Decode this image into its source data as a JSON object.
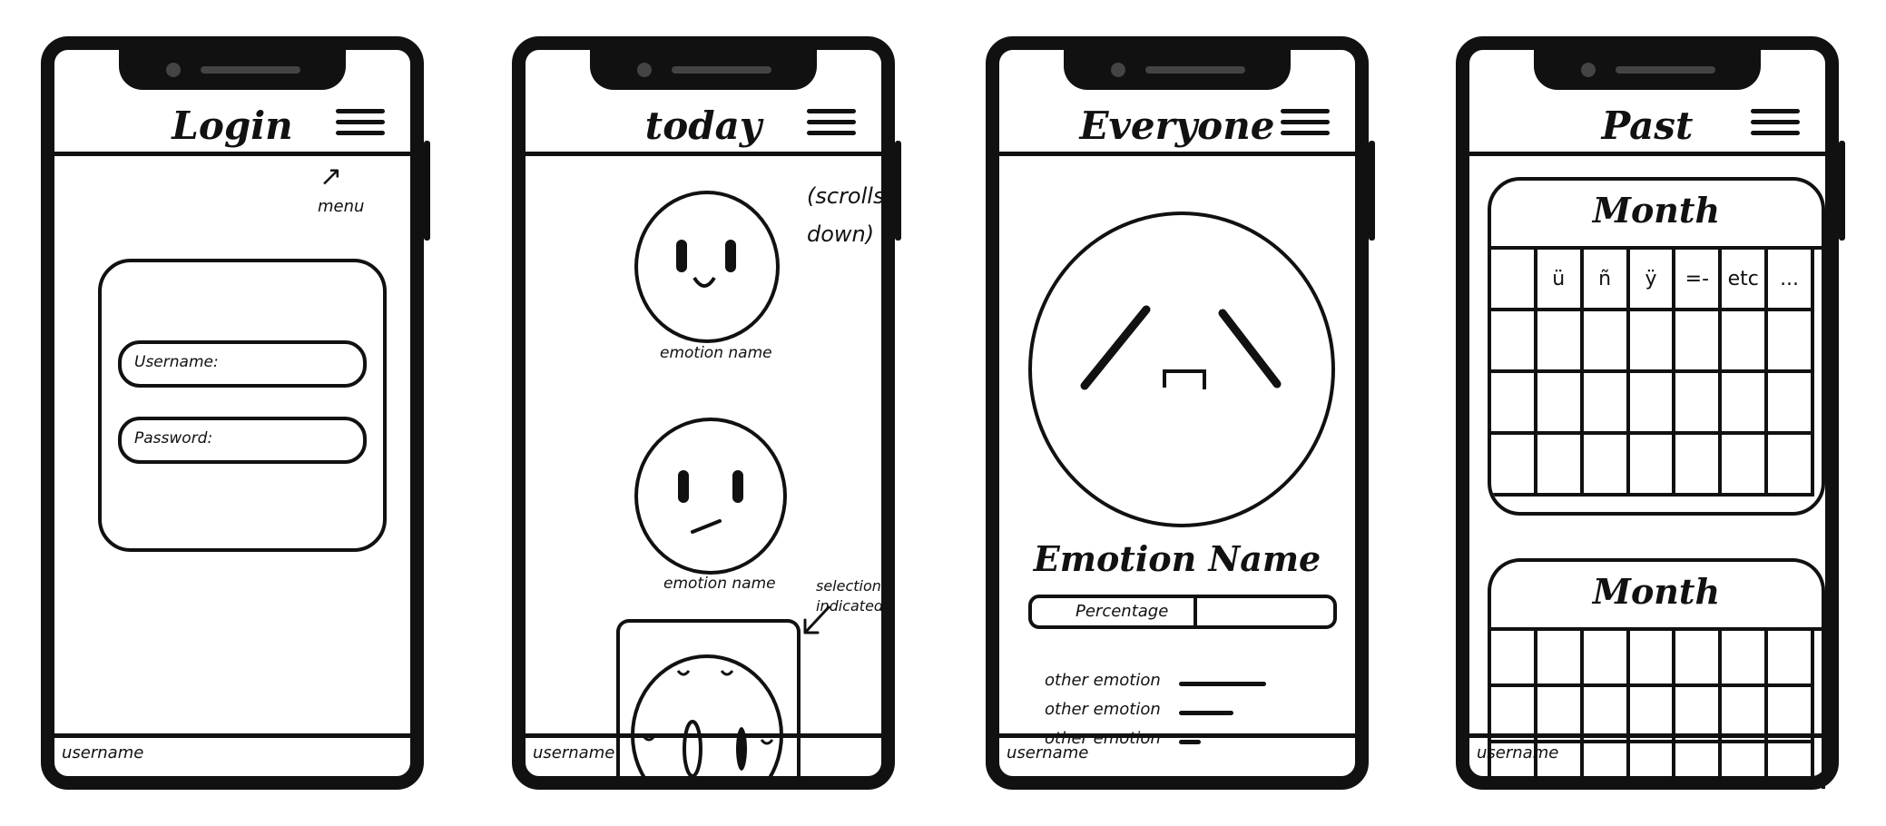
{
  "screens": [
    {
      "title": "Login",
      "menu_annotation": "menu",
      "fields": [
        {
          "label": "Username:"
        },
        {
          "label": "Password:"
        }
      ],
      "footer_username": "username"
    },
    {
      "title": "today",
      "scroll_note": "(scrolls down)",
      "emotions": [
        {
          "label": "emotion name"
        },
        {
          "label": "emotion name"
        }
      ],
      "selection_note": "selection indicated",
      "footer_username": "username"
    },
    {
      "title": "Everyone",
      "emotion_name": "Emotion Name",
      "percentage_label": "Percentage",
      "percentage_fraction": 0.55,
      "other_emotions": [
        {
          "label": "other emotion",
          "fraction": 0.8
        },
        {
          "label": "other emotion",
          "fraction": 0.5
        },
        {
          "label": "other emotion",
          "fraction": 0.2
        }
      ],
      "footer_username": "username"
    },
    {
      "title": "Past",
      "calendars": [
        {
          "month_label": "Month",
          "first_row": [
            "",
            "ü",
            "ñ",
            "ÿ",
            "=-",
            "etc",
            "..."
          ]
        },
        {
          "month_label": "Month"
        }
      ],
      "footer_username": "username"
    }
  ]
}
